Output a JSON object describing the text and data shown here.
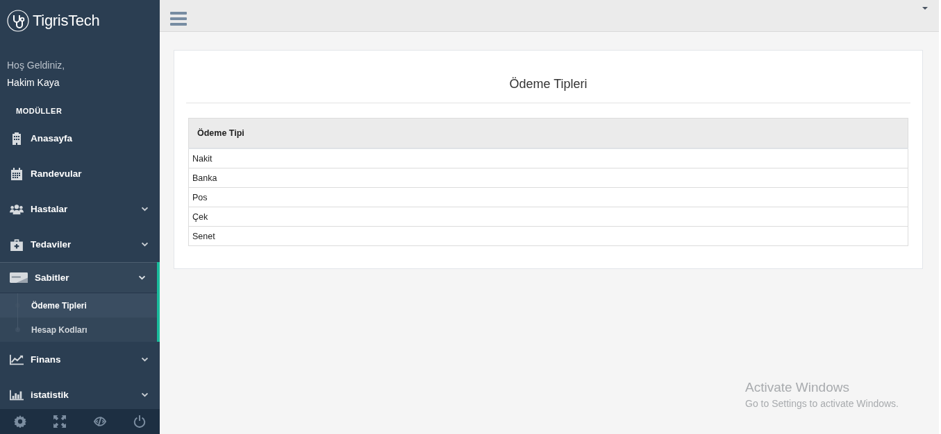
{
  "brand": {
    "name": "TigrisTech"
  },
  "welcome": {
    "greeting": "Hoş Geldiniz,",
    "user": "Hakim Kaya"
  },
  "sidebar": {
    "section_title": "MODÜLLER",
    "items": [
      {
        "label": "Anasayfa",
        "selected": false
      },
      {
        "label": "Randevular",
        "selected": false
      },
      {
        "label": "Hastalar",
        "expanded": false,
        "selected": false
      },
      {
        "label": "Tedaviler",
        "expanded": false,
        "selected": false
      },
      {
        "label": "Sabitler",
        "expanded": true,
        "selected": true,
        "children": [
          {
            "label": "Ödeme Tipleri",
            "selected": true
          },
          {
            "label": "Hesap Kodları",
            "selected": false
          }
        ]
      },
      {
        "label": "Finans",
        "expanded": false,
        "selected": false
      },
      {
        "label": "istatistik",
        "expanded": false,
        "selected": false
      }
    ]
  },
  "panel": {
    "title": "Ödeme Tipleri",
    "table": {
      "columns": [
        "Ödeme Tipi"
      ],
      "rows": [
        [
          "Nakit"
        ],
        [
          "Banka"
        ],
        [
          "Pos"
        ],
        [
          "Çek"
        ],
        [
          "Senet"
        ]
      ]
    }
  },
  "os_notice": {
    "title": "Activate Windows",
    "text": "Go to Settings to activate Windows."
  }
}
